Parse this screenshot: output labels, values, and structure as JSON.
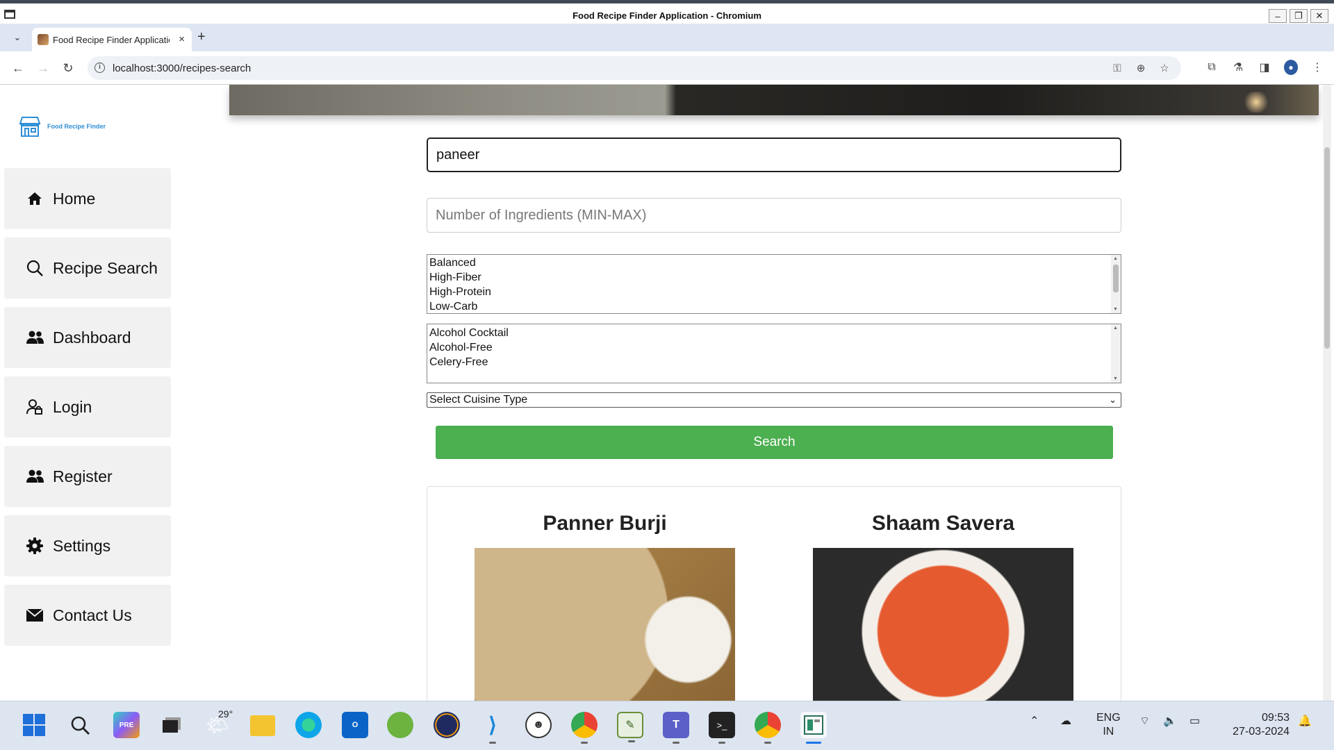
{
  "window": {
    "title": "Food Recipe Finder Application - Chromium"
  },
  "browser": {
    "tab_title": "Food Recipe Finder Application",
    "new_tab": "+",
    "url": "localhost:3000/recipes-search"
  },
  "brand": {
    "name": "Food Recipe Finder",
    "icon": "store-icon"
  },
  "sidebar": {
    "items": [
      {
        "label": "Home",
        "icon": "home-icon"
      },
      {
        "label": "Recipe Search",
        "icon": "search-icon"
      },
      {
        "label": "Dashboard",
        "icon": "users-icon"
      },
      {
        "label": "Login",
        "icon": "user-lock-icon"
      },
      {
        "label": "Register",
        "icon": "users-icon"
      },
      {
        "label": "Settings",
        "icon": "gear-icon"
      },
      {
        "label": "Contact Us",
        "icon": "mail-icon"
      }
    ]
  },
  "form": {
    "query_value": "paneer",
    "ingredients_placeholder": "Number of Ingredients (MIN-MAX)",
    "diet_options": [
      "Balanced",
      "High-Fiber",
      "High-Protein",
      "Low-Carb"
    ],
    "health_options": [
      "Alcohol Cocktail",
      "Alcohol-Free",
      "Celery-Free"
    ],
    "cuisine_selected": "Select Cuisine Type",
    "search_label": "Search"
  },
  "results": [
    {
      "title": "Panner Burji"
    },
    {
      "title": "Shaam Savera"
    }
  ],
  "taskbar": {
    "weather_temp": "29°",
    "language": "ENG",
    "region": "IN",
    "time": "09:53",
    "date": "27-03-2024"
  },
  "colors": {
    "accent_green": "#4caf50",
    "brand_blue": "#2f8fd6"
  }
}
